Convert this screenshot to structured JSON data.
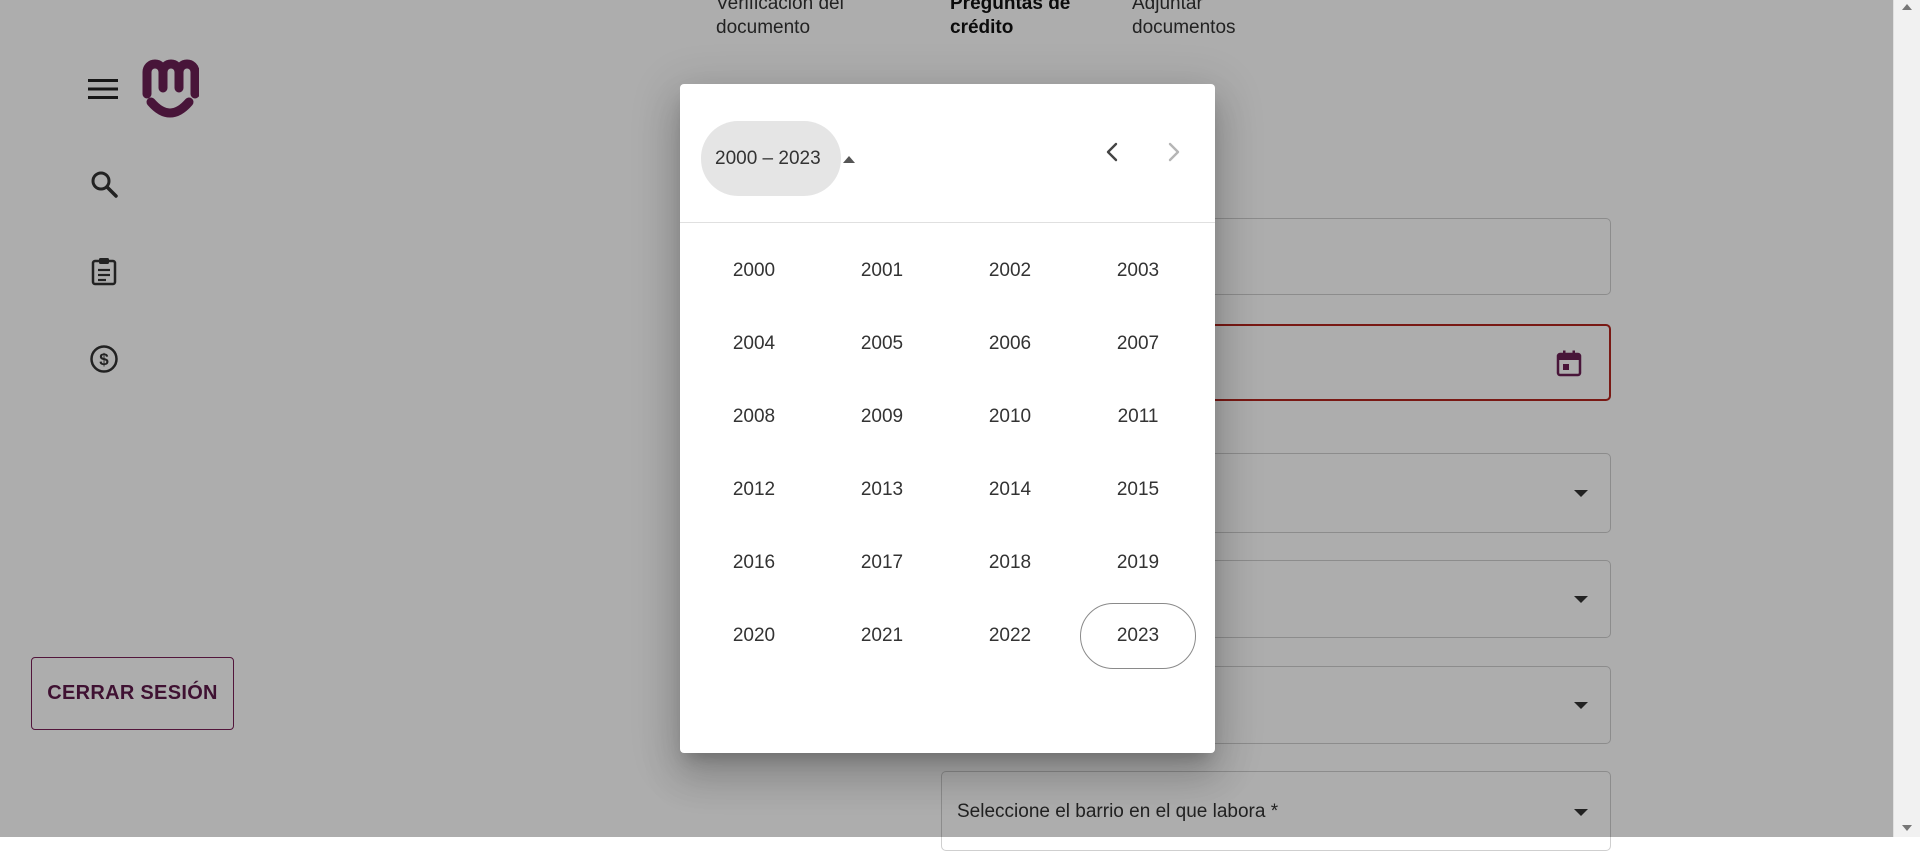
{
  "sidebar": {
    "icons": [
      "menu-icon",
      "brand-logo",
      "search-icon",
      "clipboard-icon",
      "dollar-circle-icon"
    ],
    "logout_label": "CERRAR SESIÓN"
  },
  "steps": [
    {
      "label": "Verificación del\ndocumento",
      "active": false
    },
    {
      "label": "Preguntas de\ncrédito",
      "active": true
    },
    {
      "label": "Adjuntar\ndocumentos",
      "active": false
    }
  ],
  "form": {
    "barrio_label": "Seleccione el barrio en el que labora *"
  },
  "picker": {
    "period_label": "2000 – 2023",
    "years": [
      "2000",
      "2001",
      "2002",
      "2003",
      "2004",
      "2005",
      "2006",
      "2007",
      "2008",
      "2009",
      "2010",
      "2011",
      "2012",
      "2013",
      "2014",
      "2015",
      "2016",
      "2017",
      "2018",
      "2019",
      "2020",
      "2021",
      "2022",
      "2023"
    ],
    "current_year": "2023"
  },
  "colors": {
    "brand": "#6b1f55",
    "error": "#b3261e",
    "backdrop": "rgba(0,0,0,0.32)"
  }
}
